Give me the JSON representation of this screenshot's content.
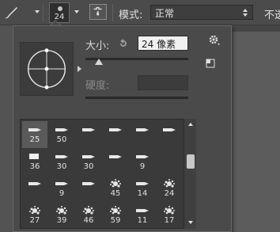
{
  "toolbar": {
    "brush_size": "24",
    "mode_label": "模式:",
    "mode_value": "正常",
    "trailing_label": "不透"
  },
  "popup": {
    "size_label": "大小:",
    "size_value": "24 像素",
    "hardness_label": "硬度:",
    "size_slider_fraction": 0.13
  },
  "brushes": [
    {
      "label": "25",
      "kind": "tip"
    },
    {
      "label": "50",
      "kind": "tip"
    },
    {
      "label": "",
      "kind": "tip"
    },
    {
      "label": "",
      "kind": "tip"
    },
    {
      "label": "",
      "kind": "tip"
    },
    {
      "label": "",
      "kind": "tip"
    },
    {
      "label": "36",
      "kind": "block"
    },
    {
      "label": "30",
      "kind": "tip"
    },
    {
      "label": "30",
      "kind": "tip"
    },
    {
      "label": "",
      "kind": "tip"
    },
    {
      "label": "9",
      "kind": "tip"
    },
    {
      "label": "",
      "kind": "blank"
    },
    {
      "label": "",
      "kind": "tip"
    },
    {
      "label": "9",
      "kind": "tip"
    },
    {
      "label": "",
      "kind": "tip"
    },
    {
      "label": "45",
      "kind": "splat"
    },
    {
      "label": "14",
      "kind": "tip"
    },
    {
      "label": "24",
      "kind": "splat"
    },
    {
      "label": "27",
      "kind": "splat"
    },
    {
      "label": "39",
      "kind": "splat"
    },
    {
      "label": "46",
      "kind": "splat"
    },
    {
      "label": "59",
      "kind": "splat"
    },
    {
      "label": "11",
      "kind": "tip"
    },
    {
      "label": "17",
      "kind": "splat"
    }
  ],
  "colors": {
    "background": "#535353",
    "panel": "#4a4a4a",
    "list": "#3a3a3a",
    "text": "#dadada"
  },
  "icons": {
    "tool": "brush-icon",
    "reset": "reset-icon",
    "settings": "gear-icon",
    "new_preset": "new-preset-icon"
  }
}
